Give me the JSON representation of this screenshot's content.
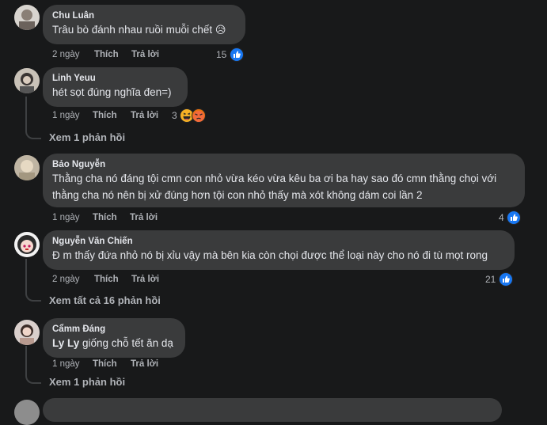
{
  "comments": [
    {
      "name": "Chu Luân",
      "text": "Trâu bò đánh nhau ruồi muỗi chết",
      "emoji": "😥",
      "time": "2 ngày",
      "like": "Thích",
      "reply": "Trả lời",
      "reactions": "15",
      "reaction_icons": [
        "like-icon"
      ]
    },
    {
      "name": "Linh Yeuu",
      "text": "hét sọt đúng nghĩa đen=)",
      "time": "1 ngày",
      "like": "Thích",
      "reply": "Trả lời",
      "reactions": "3",
      "reaction_icons": [
        "haha-icon",
        "angry-icon"
      ],
      "view_replies": "Xem 1 phản hồi"
    },
    {
      "name": "Bảo Nguyễn",
      "text_line1": "Thằng cha nó đáng tội cmn con nhỏ vừa kéo vừa kêu ba ơi ba hay sao đó cmn thằng chọi với",
      "text_line2": "thằng cha nó nên bị xử đúng hơn tội con nhỏ thấy mà xót không dám coi lần 2",
      "time": "1 ngày",
      "like": "Thích",
      "reply": "Trả lời",
      "reactions": "4",
      "reaction_icons": [
        "like-icon"
      ]
    },
    {
      "name": "Nguyễn Văn Chiến",
      "text": "Đ m thấy đứa nhỏ nó bị xỉu vậy mà bên kia còn chọi được thể loại này cho nó đi tù mọt rong",
      "time": "2 ngày",
      "like": "Thích",
      "reply": "Trả lời",
      "reactions": "21",
      "reaction_icons": [
        "like-icon"
      ],
      "view_replies": "Xem tất cả 16 phản hồi"
    },
    {
      "name": "Cẩmm Đáng",
      "mention": "Ly Ly",
      "text": " giống chỗ tết ăn dạ",
      "time": "1 ngày",
      "like": "Thích",
      "reply": "Trả lời",
      "view_replies": "Xem 1 phản hồi"
    }
  ],
  "colors": {
    "background": "#18191a",
    "bubble": "#3a3b3c",
    "like_blue": "#1877f2"
  }
}
